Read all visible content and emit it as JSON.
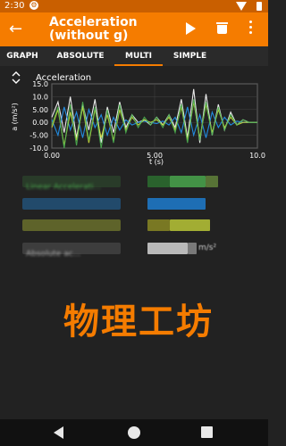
{
  "status_bar": {
    "time": "2:30"
  },
  "app_bar": {
    "title_line1": "Acceleration",
    "title_line2": "(without g)"
  },
  "tabs": [
    {
      "label": "GRAPH",
      "active": false
    },
    {
      "label": "ABSOLUTE",
      "active": false
    },
    {
      "label": "MULTI",
      "active": true
    },
    {
      "label": "SIMPLE",
      "active": false
    }
  ],
  "graph": {
    "title": "Acceleration",
    "ylabel": "a (m/s²)",
    "xlabel": "t (s)",
    "yticks": [
      "15.0",
      "10.0",
      "5.00",
      "0.00",
      "-5.00",
      "-10.0"
    ],
    "xticks": [
      "0.00",
      "5.00",
      "10.0"
    ]
  },
  "chart_data": {
    "type": "line",
    "title": "Acceleration",
    "xlabel": "t (s)",
    "ylabel": "a (m/s²)",
    "xlim": [
      0,
      10
    ],
    "ylim": [
      -10,
      15
    ],
    "series": [
      {
        "color": "#ffffff",
        "x": [
          0,
          0.3,
          0.6,
          0.9,
          1.2,
          1.5,
          1.8,
          2.1,
          2.4,
          2.7,
          3.0,
          3.3,
          3.6,
          3.9,
          4.2,
          4.5,
          4.8,
          5.1,
          5.4,
          5.7,
          6.0,
          6.3,
          6.6,
          6.9,
          7.2,
          7.5,
          7.8,
          8.1,
          8.4,
          8.7,
          9.0,
          9.3,
          9.6,
          10
        ],
        "y": [
          2,
          8,
          -4,
          10,
          -6,
          7,
          -3,
          9,
          -8,
          6,
          -4,
          8,
          -2,
          3,
          0,
          1,
          -1,
          2,
          -1,
          3,
          -2,
          9,
          -6,
          13,
          -8,
          11,
          -5,
          7,
          -3,
          4,
          -1,
          1,
          0,
          0
        ]
      },
      {
        "color": "#2196f3",
        "x": [
          0,
          0.3,
          0.6,
          0.9,
          1.2,
          1.5,
          1.8,
          2.1,
          2.4,
          2.7,
          3.0,
          3.3,
          3.6,
          3.9,
          4.2,
          4.5,
          4.8,
          5.1,
          5.4,
          5.7,
          6.0,
          6.3,
          6.6,
          6.9,
          7.2,
          7.5,
          7.8,
          8.1,
          8.4,
          8.7,
          9.0,
          9.3,
          9.6,
          10
        ],
        "y": [
          1,
          -5,
          6,
          -3,
          4,
          -6,
          5,
          -2,
          3,
          -5,
          2,
          -3,
          1,
          -1,
          0,
          0.5,
          0,
          -0.5,
          0.5,
          -1,
          2,
          -4,
          6,
          -5,
          3,
          -6,
          4,
          -2,
          2,
          -1,
          0.5,
          0,
          0,
          0
        ]
      },
      {
        "color": "#cddc39",
        "x": [
          0,
          0.3,
          0.6,
          0.9,
          1.2,
          1.5,
          1.8,
          2.1,
          2.4,
          2.7,
          3.0,
          3.3,
          3.6,
          3.9,
          4.2,
          4.5,
          4.8,
          5.1,
          5.4,
          5.7,
          6.0,
          6.3,
          6.6,
          6.9,
          7.2,
          7.5,
          7.8,
          8.1,
          8.4,
          8.7,
          9.0,
          9.3,
          9.6,
          10
        ],
        "y": [
          -2,
          5,
          -9,
          4,
          -7,
          6,
          -8,
          5,
          -6,
          3,
          -7,
          5,
          -3,
          2,
          -1,
          1,
          0,
          1,
          -1,
          2,
          -3,
          6,
          -7,
          8,
          -6,
          7,
          -4,
          5,
          -2,
          2,
          -1,
          0,
          0,
          0
        ]
      },
      {
        "color": "#4caf50",
        "x": [
          0,
          0.3,
          0.6,
          0.9,
          1.2,
          1.5,
          1.8,
          2.1,
          2.4,
          2.7,
          3.0,
          3.3,
          3.6,
          3.9,
          4.2,
          4.5,
          4.8,
          5.1,
          5.4,
          5.7,
          6.0,
          6.3,
          6.6,
          6.9,
          7.2,
          7.5,
          7.8,
          8.1,
          8.4,
          8.7,
          9.0,
          9.3,
          9.6,
          10
        ],
        "y": [
          -1,
          6,
          -10,
          7,
          -9,
          8,
          -7,
          6,
          -10,
          5,
          -8,
          7,
          -4,
          3,
          -2,
          2,
          -1,
          2,
          -2,
          3,
          -4,
          7,
          -8,
          9,
          -7,
          8,
          -5,
          6,
          -3,
          3,
          -1,
          1,
          0,
          0
        ]
      }
    ]
  },
  "value_rows": [
    {
      "label": "Linear Accelerati...",
      "label_color": "#4caf50",
      "value_color": "#4caf50",
      "value_color_2": "#8bc34a"
    },
    {
      "label": "",
      "label_color": "#2196f3",
      "value_color": "#2196f3",
      "value_color_2": "#64b5f6"
    },
    {
      "label": "",
      "label_color": "#cddc39",
      "value_color": "#cddc39",
      "value_color_2": "#e6ee9c"
    },
    {
      "label": "Absolute ac...",
      "label_color": "#bdbdbd",
      "value_color": "#e0e0e0",
      "value_color_2": "#9e9e9e",
      "unit": "m/s²"
    }
  ],
  "watermark": "物理工坊",
  "colors": {
    "accent": "#f57c00",
    "status_bar": "#c95f00",
    "background": "#222222"
  },
  "icons": [
    "back-arrow-icon",
    "play-icon",
    "trash-icon",
    "overflow-menu-icon",
    "expand-collapse-icon",
    "nav-back-icon",
    "nav-home-icon",
    "nav-recents-icon",
    "settings-gear-icon",
    "wifi-icon",
    "battery-icon"
  ]
}
